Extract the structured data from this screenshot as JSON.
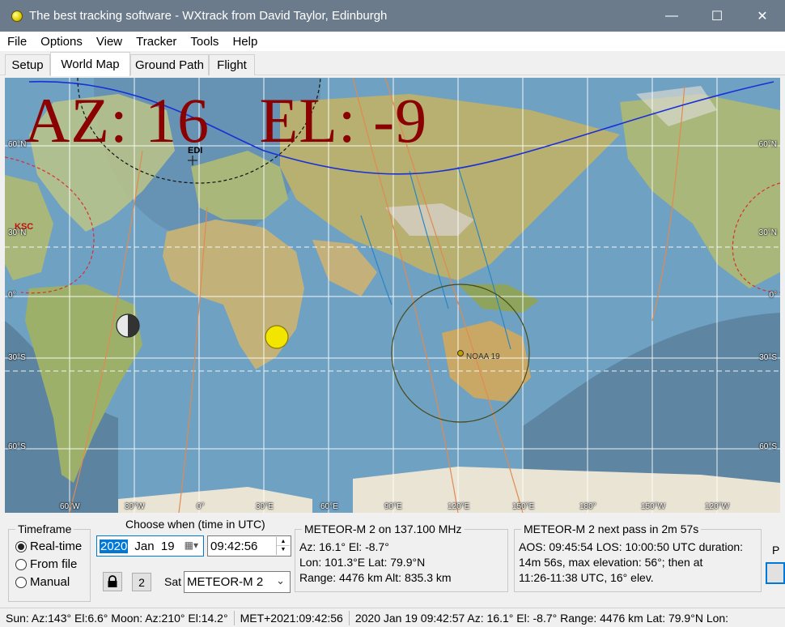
{
  "window": {
    "title": "The best tracking software - WXtrack from David Taylor, Edinburgh",
    "minimize": "—",
    "maximize": "☐",
    "close": "✕"
  },
  "menu": [
    "File",
    "Options",
    "View",
    "Tracker",
    "Tools",
    "Help"
  ],
  "tabs": [
    "Setup",
    "World Map",
    "Ground Path",
    "Flight"
  ],
  "active_tab": "World Map",
  "map": {
    "az_el": "AZ: 16   EL: -9",
    "locations": {
      "edinburgh": "EDI",
      "ksc": "KSC"
    },
    "satellite_label": "NOAA 19",
    "lat_labels": [
      "60°N",
      "30°N",
      "0°",
      "30°S",
      "60°S"
    ],
    "lon_labels": [
      "60°W",
      "30°W",
      "0°",
      "30°E",
      "60°E",
      "90°E",
      "120°E",
      "150°E",
      "180°",
      "150°W",
      "120°W"
    ],
    "colors": {
      "ocean": "#6fa1c3",
      "land": "#a8b86c",
      "ground_track": "#1a2fd8",
      "orbit_lines": "#e08a50",
      "azel_text": "#8b0000"
    }
  },
  "timeframe": {
    "title": "Timeframe",
    "options": [
      "Real-time",
      "From file",
      "Manual"
    ],
    "selected": "Real-time"
  },
  "when": {
    "title": "Choose when (time in UTC)",
    "year": "2020",
    "month_day": "Jan  19",
    "time": "09:42:56",
    "lock_icon": "lock-icon",
    "count_button": "2",
    "sat_label": "Sat",
    "sat_value": "METEOR-M 2"
  },
  "current_sat": {
    "title": "METEOR-M 2 on 137.100 MHz",
    "line1": "Az: 16.1°  El: -8.7°",
    "line2": "Lon: 101.3°E  Lat: 79.9°N",
    "line3": "Range: 4476 km  Alt: 835.3 km"
  },
  "next_pass": {
    "title": "METEOR-M 2 next pass in 2m 57s",
    "line1": "AOS: 09:45:54  LOS: 10:00:50 UTC  duration:",
    "line2": "14m 56s,  max elevation: 56°;  then at",
    "line3": "11:26-11:38 UTC, 16° elev."
  },
  "edge_fragment": "P",
  "status": {
    "sun_moon": "Sun: Az:143° El:6.6°  Moon: Az:210° El:14.2°",
    "met": "MET+2021:09:42:56",
    "detail": "2020 Jan 19  09:42:57  Az: 16.1°  El: -8.7°  Range: 4476 km  Lat: 79.9°N  Lon:"
  }
}
